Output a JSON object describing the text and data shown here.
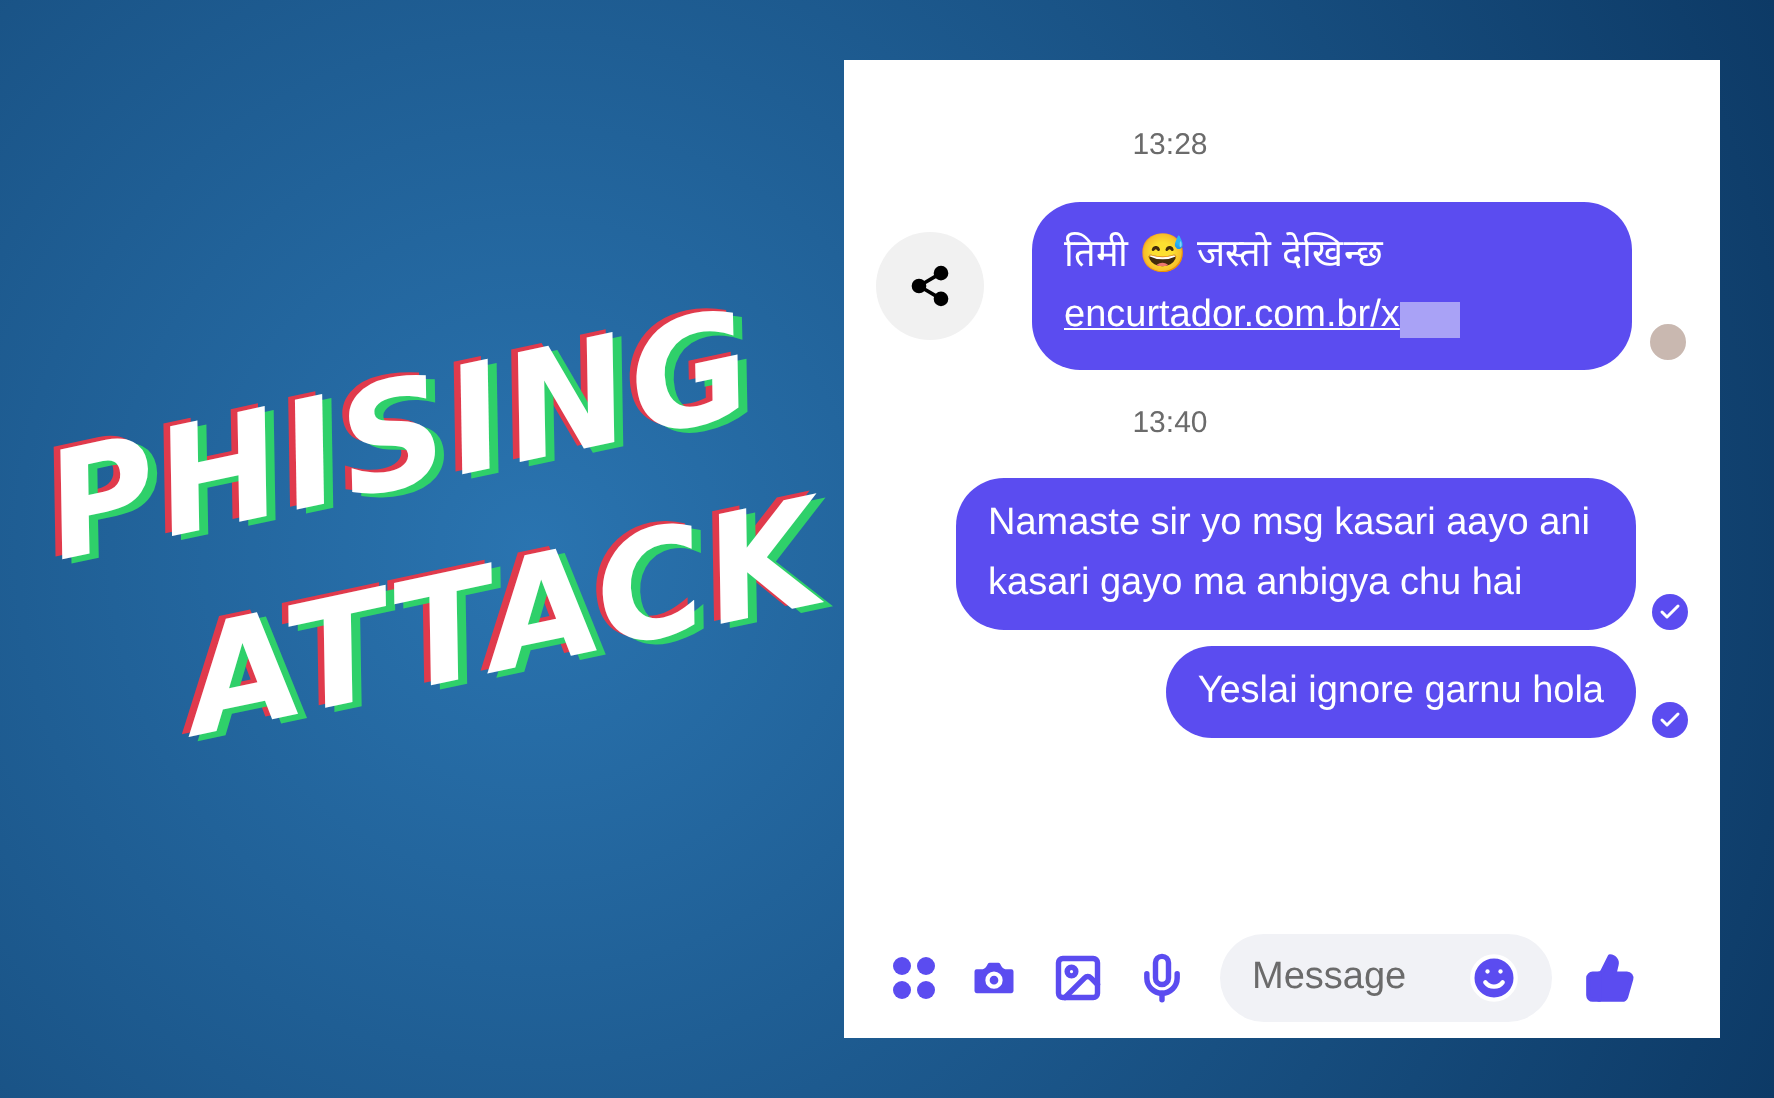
{
  "headline": {
    "lines": [
      "PHISING",
      "ATTACK"
    ]
  },
  "chat": {
    "messages": [
      {
        "kind": "time",
        "text": "13:28"
      },
      {
        "kind": "link",
        "text": "तिमी 😅 जस्तो देखिन्छ",
        "link": "encurtador.com.br/x",
        "tick": false
      },
      {
        "kind": "time",
        "text": "13:40"
      },
      {
        "kind": "text",
        "text": "Namaste sir yo msg kasari aayo ani kasari gayo ma anbigya chu hai",
        "tick": true
      },
      {
        "kind": "text",
        "text": "Yeslai ignore garnu hola",
        "tick": true
      }
    ],
    "composer": {
      "placeholder": "Message"
    }
  }
}
